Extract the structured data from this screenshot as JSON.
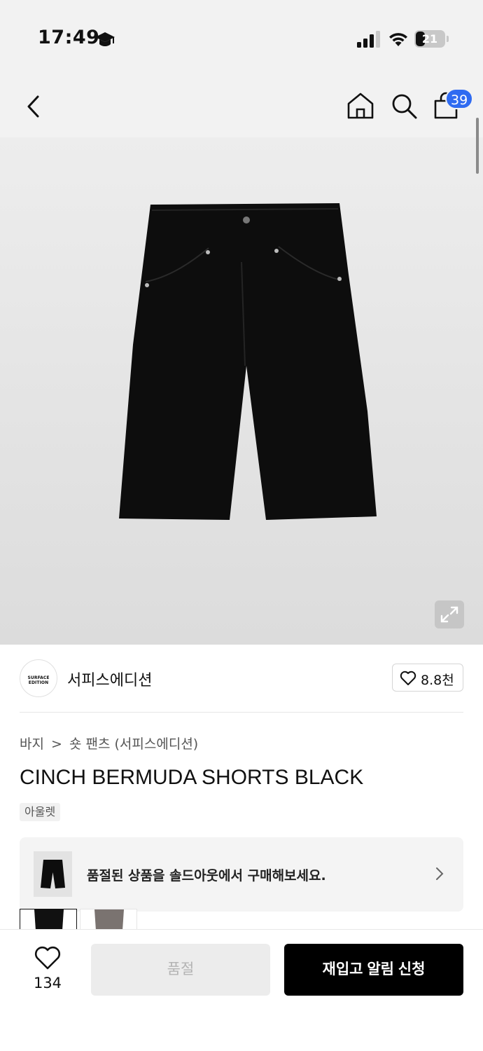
{
  "status_bar": {
    "time": "17:49",
    "battery": "21",
    "icons": [
      "graduation-cap-icon",
      "signal-icon",
      "wifi-icon",
      "battery-icon"
    ]
  },
  "nav": {
    "icons": [
      "back-chevron-icon",
      "home-icon",
      "search-icon",
      "shopping-bag-icon"
    ],
    "cart_count": "39"
  },
  "product": {
    "image_alt": "black bermuda shorts",
    "brand": {
      "logo_text": "SURFACE EDITION",
      "name": "서피스에디션",
      "likes": "8.8천"
    },
    "breadcrumb": {
      "category": "바지",
      "separator": ">",
      "subcategory": "숏 팬츠 (서피스에디션)"
    },
    "title": "CINCH BERMUDA SHORTS BLACK",
    "tag": "아울렛"
  },
  "soldout_banner": {
    "text": "품절된 상품을 솔드아웃에서 구매해보세요."
  },
  "bottom_bar": {
    "wish_count": "134",
    "soldout_label": "품절",
    "restock_label": "재입고 알림 신청"
  },
  "colors": {
    "accent_badge": "#2f6bf1",
    "primary_button": "#000000",
    "disabled_button": "#ececec"
  }
}
